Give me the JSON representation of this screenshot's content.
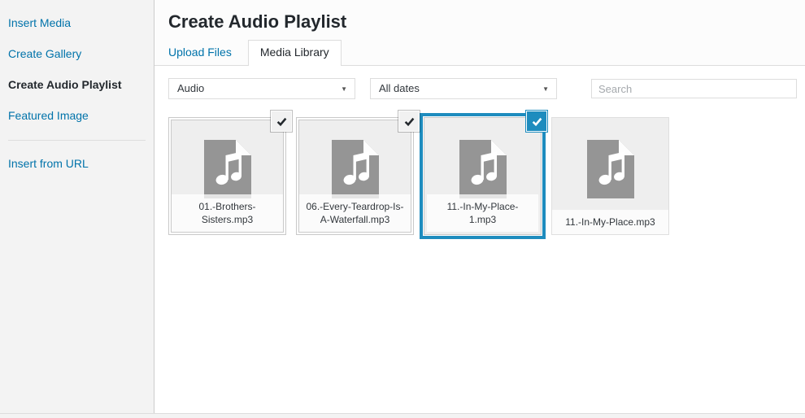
{
  "sidebar": {
    "primary_items": [
      {
        "label": "Insert Media",
        "active": false
      },
      {
        "label": "Create Gallery",
        "active": false
      },
      {
        "label": "Create Audio Playlist",
        "active": true
      },
      {
        "label": "Featured Image",
        "active": false
      }
    ],
    "secondary_items": [
      {
        "label": "Insert from URL",
        "active": false
      }
    ]
  },
  "header": {
    "title": "Create Audio Playlist"
  },
  "router": {
    "tabs": [
      {
        "label": "Upload Files",
        "active": false
      },
      {
        "label": "Media Library",
        "active": true
      }
    ]
  },
  "toolbar": {
    "type_filter_value": "Audio",
    "date_filter_value": "All dates",
    "search_placeholder": "Search"
  },
  "attachments": [
    {
      "filename": "01.-Brothers-Sisters.mp3",
      "selected": true,
      "focused": false
    },
    {
      "filename": "06.-Every-Teardrop-Is-A-Waterfall.mp3",
      "selected": true,
      "focused": false
    },
    {
      "filename": "11.-In-My-Place-1.mp3",
      "selected": true,
      "focused": true
    },
    {
      "filename": "11.-In-My-Place.mp3",
      "selected": false,
      "focused": false
    }
  ],
  "colors": {
    "accent_blue": "#1e8cbe",
    "link_blue": "#0073aa",
    "sidebar_bg": "#f3f3f3",
    "header_bg": "#fcfcfc",
    "card_bg": "#eeeeee",
    "icon_gray": "#959595"
  },
  "icons": {
    "audio_file": "audio-file-icon",
    "check": "check-icon",
    "select_arrow": "chevron-down-icon"
  }
}
